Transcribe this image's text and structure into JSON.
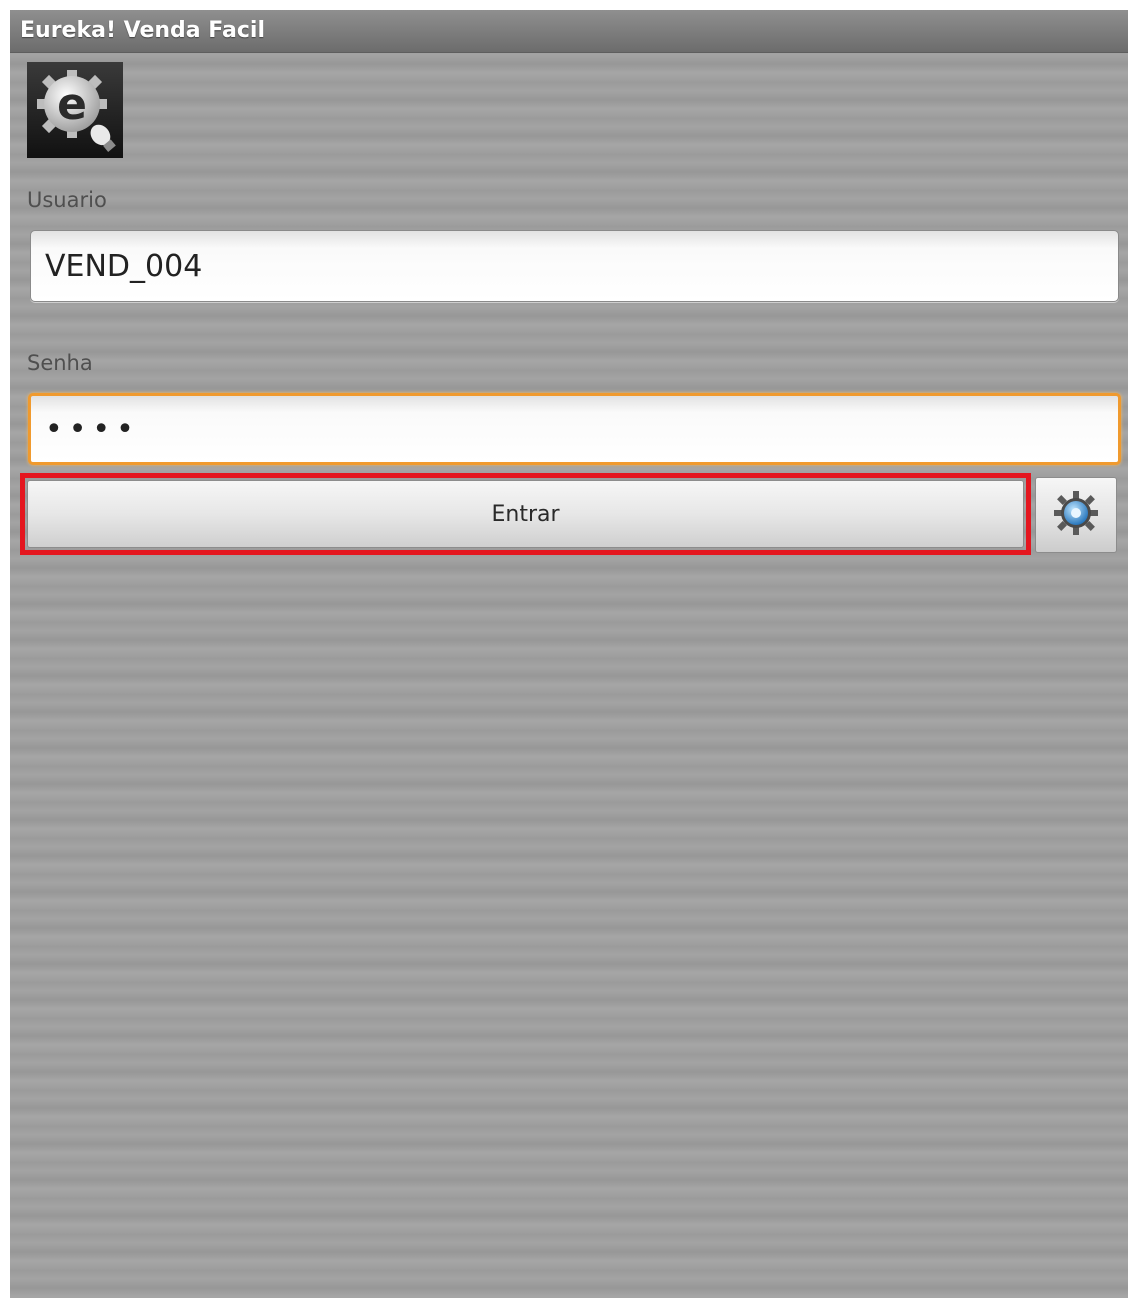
{
  "app": {
    "title": "Eureka! Venda Facil",
    "logo_icon": "eureka-e-lightbulb-logo"
  },
  "form": {
    "user_label": "Usuario",
    "user_value": "VEND_004",
    "password_label": "Senha",
    "password_value": "••••",
    "login_label": "Entrar",
    "settings_icon": "gear-icon"
  },
  "colors": {
    "focus_border": "#f09a2e",
    "highlight_box": "#e4161f",
    "title_text": "#ffffff"
  }
}
